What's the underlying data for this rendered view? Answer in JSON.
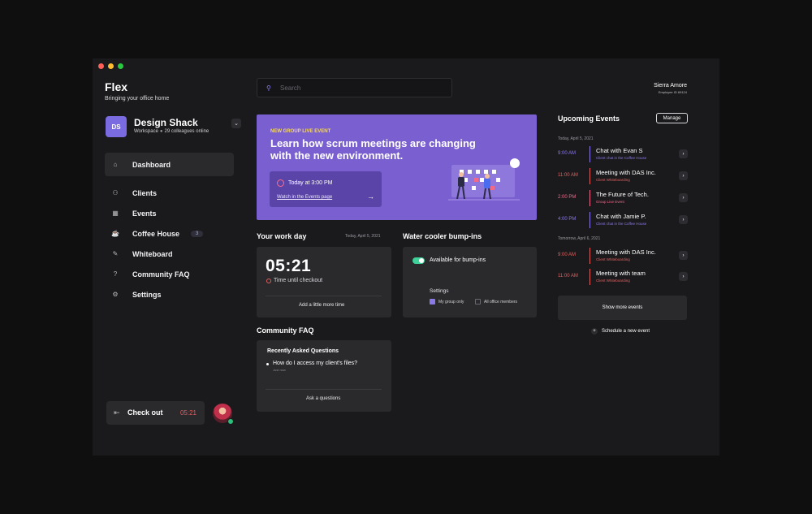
{
  "app": {
    "title": "Flex",
    "subtitle": "Bringing your office home"
  },
  "workspace": {
    "initials": "DS",
    "name": "Design Shack",
    "type": "Workspace",
    "online": "29 colleagues online"
  },
  "nav": [
    {
      "label": "Dashboard",
      "icon": "home-icon",
      "active": true
    },
    {
      "label": "Clients",
      "icon": "user-icon"
    },
    {
      "label": "Events",
      "icon": "calendar-icon"
    },
    {
      "label": "Coffee House",
      "icon": "coffee-icon",
      "badge": "3"
    },
    {
      "label": "Whiteboard",
      "icon": "pencil-icon"
    },
    {
      "label": "Community FAQ",
      "icon": "question-icon"
    },
    {
      "label": "Settings",
      "icon": "gear-icon"
    }
  ],
  "checkout": {
    "label": "Check out",
    "time": "05:21"
  },
  "search": {
    "placeholder": "Search"
  },
  "user": {
    "name": "Sierra Amore",
    "id": "Employee ID 69124"
  },
  "banner": {
    "tag": "NEW GROUP LIVE EVENT",
    "title": "Learn how scrum meetings are changing with the new environment.",
    "time": "Today at 3:00 PM",
    "link": "Watch in the Events page"
  },
  "workday": {
    "title": "Your work day",
    "date": "Today, April 5, 2021",
    "time": "05:21",
    "time_label": "Time until checkout",
    "action": "Add a little more time"
  },
  "watercooler": {
    "title": "Water cooler bump-ins",
    "toggle_label": "Available for bump-ins",
    "settings_label": "Settings",
    "option1": "My group only",
    "option2": "All office members"
  },
  "faq": {
    "title": "Community FAQ",
    "subtitle": "Recently Asked Questions",
    "question": "How do I access my client's files?",
    "question_meta": "Just now",
    "action": "Ask a questions"
  },
  "events": {
    "title": "Upcoming Events",
    "manage": "Manage",
    "day1": "Today, April 5, 2021",
    "day2": "Tomorrow, April 6, 2021",
    "items": [
      {
        "time": "9:00 AM",
        "title": "Chat with Evan S",
        "sub": "Client chat in the Coffee House",
        "color": "#8a7ae8"
      },
      {
        "time": "11:00 AM",
        "title": "Meeting with DAS Inc.",
        "sub": "Client Whiteboarding",
        "color": "#e06060"
      },
      {
        "time": "2:00 PM",
        "title": "The Future of Tech.",
        "sub": "Group Live Event",
        "color": "#f06b8b"
      },
      {
        "time": "4:00 PM",
        "title": "Chat with Jamie P.",
        "sub": "Client chat in the Coffee House",
        "color": "#8a7ae8"
      },
      {
        "time": "9:00 AM",
        "title": "Meeting with DAS Inc.",
        "sub": "Client Whiteboarding",
        "color": "#e06060"
      },
      {
        "time": "11:00 AM",
        "title": "Meeting with team",
        "sub": "Client Whiteboarding",
        "color": "#e06060"
      }
    ],
    "show_more": "Show more events",
    "schedule": "Schedule a new event"
  }
}
